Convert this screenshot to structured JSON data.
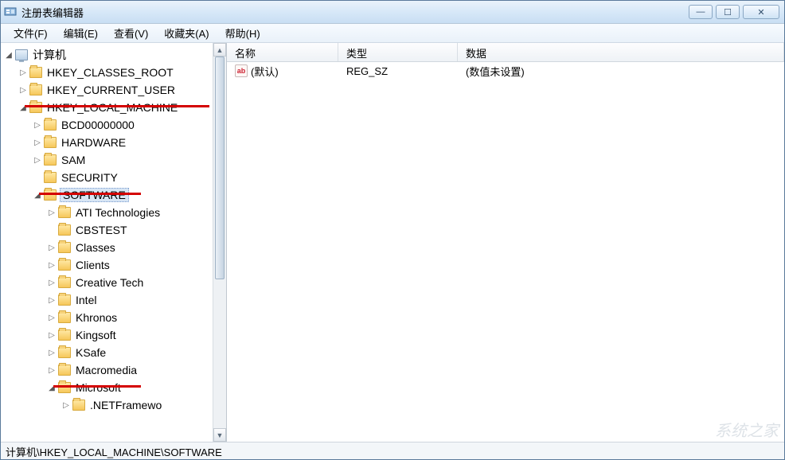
{
  "window": {
    "title": "注册表编辑器"
  },
  "menubar": {
    "file": "文件(F)",
    "edit": "编辑(E)",
    "view": "查看(V)",
    "favorites": "收藏夹(A)",
    "help": "帮助(H)"
  },
  "tree": {
    "root": "计算机",
    "hkcr": "HKEY_CLASSES_ROOT",
    "hkcu": "HKEY_CURRENT_USER",
    "hklm": "HKEY_LOCAL_MACHINE",
    "hklm_children": {
      "bcd": "BCD00000000",
      "hardware": "HARDWARE",
      "sam": "SAM",
      "security": "SECURITY",
      "software": "SOFTWARE"
    },
    "software_children": {
      "ati": "ATI Technologies",
      "cbstest": "CBSTEST",
      "classes": "Classes",
      "clients": "Clients",
      "creative": "Creative Tech",
      "intel": "Intel",
      "khronos": "Khronos",
      "kingsoft": "Kingsoft",
      "ksafe": "KSafe",
      "macromedia": "Macromedia",
      "microsoft": "Microsoft"
    },
    "microsoft_children": {
      "netframework": ".NETFramewo"
    }
  },
  "list": {
    "columns": {
      "name": "名称",
      "type": "类型",
      "data": "数据"
    },
    "rows": [
      {
        "name": "(默认)",
        "type": "REG_SZ",
        "data": "(数值未设置)"
      }
    ]
  },
  "statusbar": {
    "path": "计算机\\HKEY_LOCAL_MACHINE\\SOFTWARE"
  },
  "watermark": "系统之家",
  "icons": {
    "value_ab": "ab"
  }
}
